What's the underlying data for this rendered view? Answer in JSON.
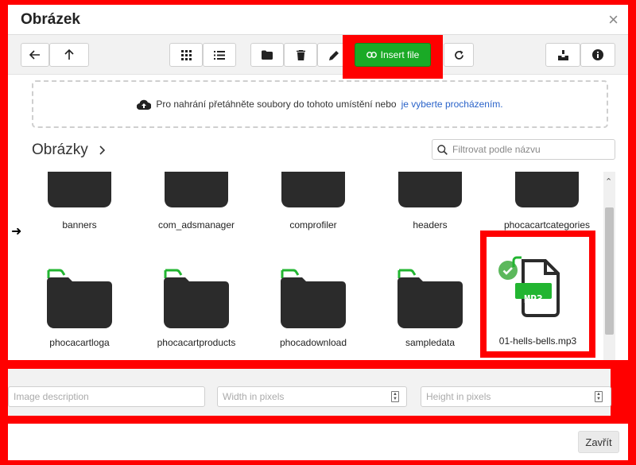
{
  "dialog": {
    "title": "Obrázek",
    "close_symbol": "×"
  },
  "toolbar": {
    "insert_label": "Insert file"
  },
  "dropzone": {
    "text": "Pro nahrání přetáhněte soubory do tohoto umístění nebo",
    "link": "je vyberte procházením."
  },
  "breadcrumb": {
    "root": "Obrázky"
  },
  "filter": {
    "placeholder": "Filtrovat podle názvu"
  },
  "items": [
    {
      "name": "banners"
    },
    {
      "name": "com_adsmanager"
    },
    {
      "name": "comprofiler"
    },
    {
      "name": "headers"
    },
    {
      "name": "phocacartcategories"
    },
    {
      "name": "phocacartloga"
    },
    {
      "name": "phocacartproducts"
    },
    {
      "name": "phocadownload"
    },
    {
      "name": "sampledata"
    },
    {
      "name": "01-hells-bells.mp3",
      "badge": "MP3"
    }
  ],
  "fields": {
    "description_placeholder": "Image description",
    "width_placeholder": "Width in pixels",
    "height_placeholder": "Height in pixels"
  },
  "footer": {
    "close_label": "Zavřít"
  },
  "colors": {
    "accent_green": "#1aaa26",
    "folder_dark": "#2b2b2b",
    "folder_tab_green": "#22b531",
    "link_blue": "#2a63c9",
    "highlight_red": "#ff0000"
  }
}
